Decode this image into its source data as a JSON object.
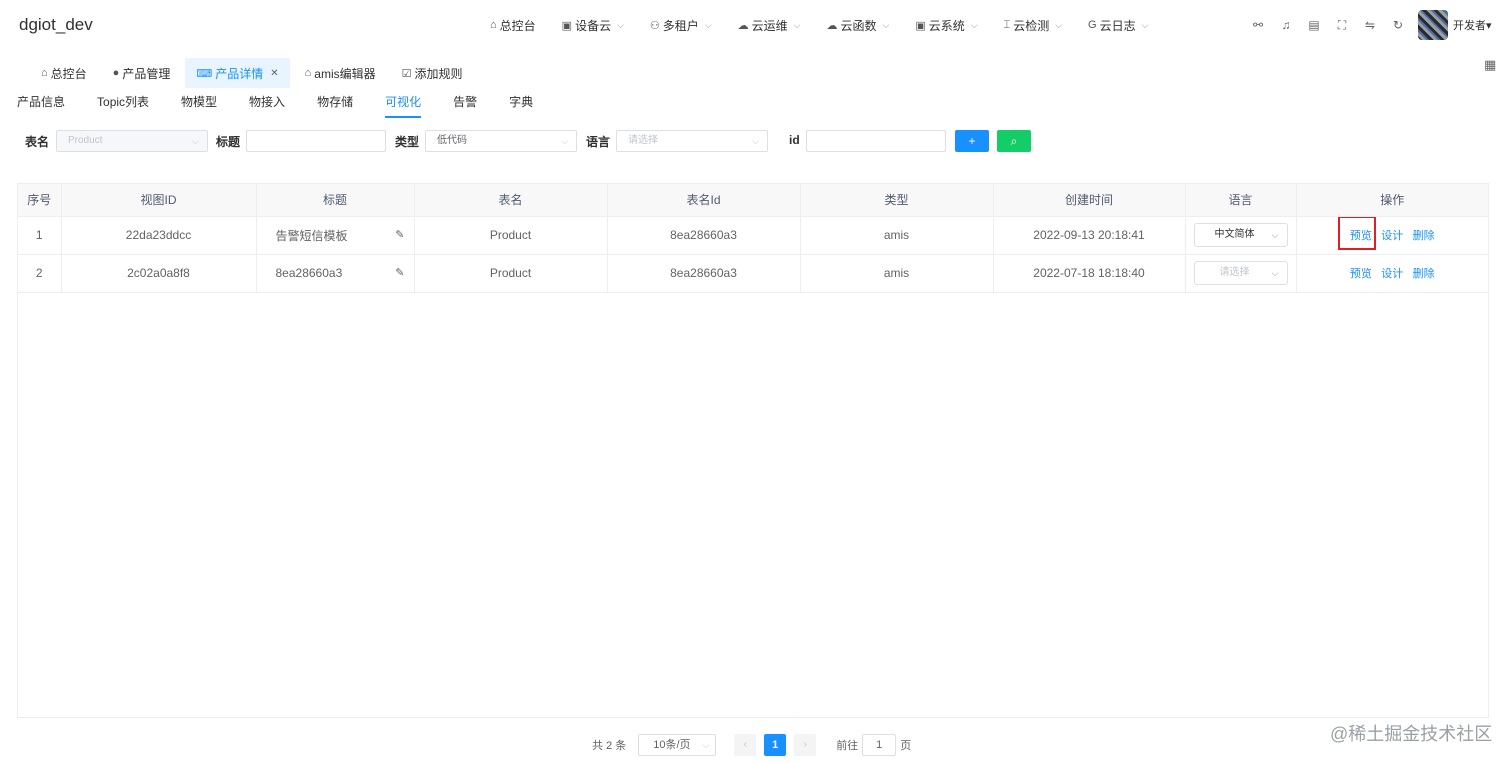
{
  "app": {
    "title": "dgiot_dev"
  },
  "nav": [
    {
      "label": "总控台",
      "icon": "home-icon",
      "dropdown": false
    },
    {
      "label": "设备云",
      "icon": "device-icon",
      "dropdown": true
    },
    {
      "label": "多租户",
      "icon": "users-icon",
      "dropdown": true
    },
    {
      "label": "云运维",
      "icon": "cloud-icon",
      "dropdown": true
    },
    {
      "label": "云函数",
      "icon": "cloud-outline-icon",
      "dropdown": true
    },
    {
      "label": "云系统",
      "icon": "system-icon",
      "dropdown": true
    },
    {
      "label": "云检测",
      "icon": "test-tube-icon",
      "dropdown": true
    },
    {
      "label": "云日志",
      "icon": "log-icon",
      "dropdown": true
    }
  ],
  "user": {
    "name": "开发者"
  },
  "tags": [
    {
      "label": "总控台",
      "icon": "home-icon"
    },
    {
      "label": "产品管理",
      "icon": "product-icon"
    },
    {
      "label": "产品详情",
      "icon": "code-icon",
      "active": true
    },
    {
      "label": "amis编辑器",
      "icon": "house-icon"
    },
    {
      "label": "添加规则",
      "icon": "rule-icon"
    }
  ],
  "subtabs": [
    "产品信息",
    "Topic列表",
    "物模型",
    "物接入",
    "物存储",
    "可视化",
    "告警",
    "字典"
  ],
  "active_subtab": "可视化",
  "filters": {
    "table_label": "表名",
    "table_value": "Product",
    "title_label": "标题",
    "title_value": "",
    "type_label": "类型",
    "type_value": "低代码",
    "lang_label": "语言",
    "lang_placeholder": "请选择",
    "id_label": "id",
    "id_value": "",
    "add_button": "+",
    "search_button": "⌕"
  },
  "table": {
    "headers": [
      "序号",
      "视图ID",
      "标题",
      "表名",
      "表名Id",
      "类型",
      "创建时间",
      "语言",
      "操作"
    ],
    "rows": [
      {
        "index": "1",
        "view_id": "22da23ddcc",
        "title": "告警短信模板",
        "table": "Product",
        "table_id": "8ea28660a3",
        "type": "amis",
        "created": "2022-09-13 20:18:41",
        "lang": "中文简体",
        "lang_placeholder": false
      },
      {
        "index": "2",
        "view_id": "2c02a0a8f8",
        "title": "8ea28660a3",
        "table": "Product",
        "table_id": "8ea28660a3",
        "type": "amis",
        "created": "2022-07-18 18:18:40",
        "lang": "请选择",
        "lang_placeholder": true
      }
    ],
    "actions": {
      "preview": "预览",
      "design": "设计",
      "delete": "删除"
    }
  },
  "pagination": {
    "total": "共 2 条",
    "page_size": "10条/页",
    "current": "1",
    "goto_prefix": "前往",
    "goto_value": "1",
    "goto_suffix": "页"
  },
  "watermark": "@稀土掘金技术社区",
  "colors": {
    "primary": "#1890ff",
    "success": "#13ce66",
    "highlight": "#e02020"
  }
}
